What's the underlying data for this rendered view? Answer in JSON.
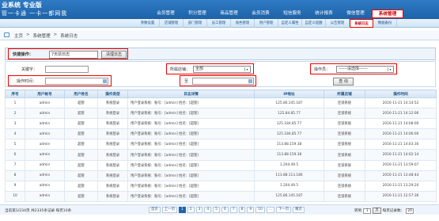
{
  "header": {
    "logo_line1": "业系统 专业版",
    "logo_line2": "管一卡通  一卡一都网我",
    "top_nav": [
      "会员管理",
      "积分管理",
      "商品管理",
      "会员消费",
      "短信服务",
      "统计报表",
      "微信管理",
      "系统管理"
    ],
    "top_nav_selected": "系统管理",
    "sub_nav": [
      "参数设置",
      "店铺管理",
      "部门管理",
      "员工管理",
      "角色管理",
      "用户管理",
      "自定义属性",
      "自定义提醒",
      "公告管理",
      "系统日志",
      "数据备份"
    ],
    "sub_nav_selected": "系统日志"
  },
  "breadcrumb": [
    "主页",
    ">",
    "系统管理",
    ">",
    "系统日志"
  ],
  "quick_ops": {
    "label": "快捷操作：",
    "select_value": "7天前日志",
    "button": "清理日志"
  },
  "search": {
    "keyword_label": "关键字：",
    "keyword_value": "",
    "store_label": "所属店铺：",
    "store_value": "全部",
    "operator_label": "操作员：",
    "operator_value": "------请选择------",
    "time_label": "操作时间：",
    "time_from": "",
    "time_sep": "至",
    "time_to": "",
    "query_button": "查 询"
  },
  "table": {
    "columns": [
      "序号",
      "用户帐号",
      "用户姓名",
      "操作类型",
      "日志详情",
      "IP地址",
      "所属店铺",
      "操作时间"
    ],
    "rows": [
      [
        "1",
        "admin",
        "超管",
        "系统登录",
        "用户登录系统：账号：[admin] 姓名：[超管]",
        "125.86.145.187",
        "连锁系统",
        "2016-11-21 14:14:52"
      ],
      [
        "2",
        "admin",
        "超管",
        "系统登录",
        "用户登录系统：账号：[admin] 姓名：[超管]",
        "125.84.85.77",
        "连锁系统",
        "2016-11-21 14:12:06"
      ],
      [
        "3",
        "admin",
        "超管",
        "系统登录",
        "用户登录系统：账号：[admin] 姓名：[超管]",
        "125.184.85.77",
        "连锁系统",
        "2016-11-21 14:08:00"
      ],
      [
        "4",
        "admin",
        "超管",
        "系统登录",
        "用户登录系统：账号：[admin] 姓名：[超管]",
        "125.184.85.77",
        "连锁系统",
        "2016-11-21 14:06:00"
      ],
      [
        "5",
        "admin",
        "超管",
        "系统登录",
        "用户登录系统：账号：[admin] 姓名：[超管]",
        "113.88.159.38",
        "连锁系统",
        "2016-11-21 14:03:30"
      ],
      [
        "6",
        "admin",
        "超管",
        "系统登录",
        "用户登录系统：账号：[admin] 姓名：[超管]",
        "113.88.159.38",
        "连锁系统",
        "2016-11-21 14:02:14"
      ],
      [
        "7",
        "admin",
        "超管",
        "系统登录",
        "用户登录系统：账号：[admin] 姓名：[超管]",
        "1.204.49.5",
        "连锁系统",
        "2016-11-21 13:59:07"
      ],
      [
        "8",
        "admin",
        "超管",
        "系统登录",
        "用户登录系统：账号：[admin] 姓名：[超管]",
        "113.88.113.186",
        "连锁系统",
        "2016-11-21 13:48:44"
      ],
      [
        "9",
        "admin",
        "超管",
        "系统登录",
        "用户登录系统：账号：[admin] 姓名：[超管]",
        "1.204.49.5",
        "连锁系统",
        "2016-11-21 13:29:20"
      ],
      [
        "10",
        "admin",
        "超管",
        "系统登录",
        "用户登录系统：账号：[admin] 姓名：[超管]",
        "125.86.145.187",
        "连锁系统",
        "2016-11-21 12:57:36"
      ]
    ]
  },
  "pager": {
    "info": "当前第1/234页 共2335条记录 每页10条",
    "first": "首页",
    "prev": "上一页",
    "pages": [
      "1",
      "2",
      "3",
      "4",
      "5",
      "6",
      "7",
      "8",
      "9",
      "10"
    ],
    "current_page": "1",
    "more": "...",
    "next": "下一页",
    "last": "尾页",
    "jump_label": "转到",
    "jump_value": "1",
    "go_button": "页",
    "page_size_label": "每页记录数：",
    "page_size_value": "20"
  }
}
